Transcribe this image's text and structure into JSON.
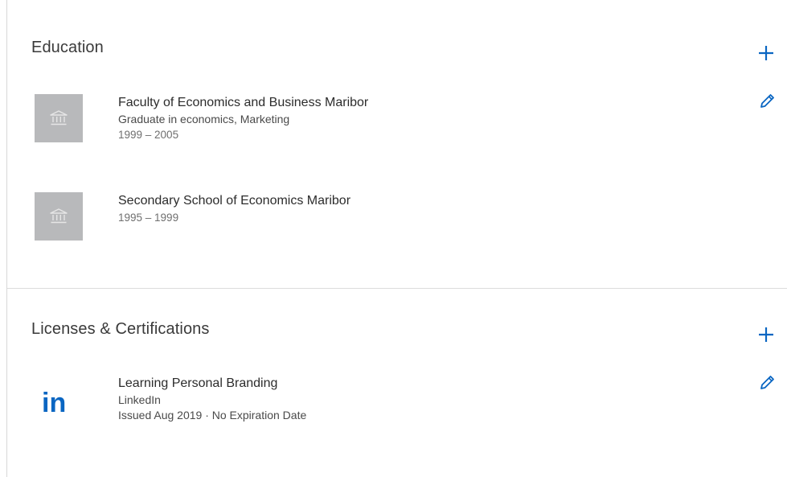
{
  "education": {
    "title": "Education",
    "add_icon": "plus-icon",
    "edit_icon": "pencil-icon",
    "entries": [
      {
        "school": "Faculty of Economics and Business Maribor",
        "degree": "Graduate in economics, Marketing",
        "dates": "1999 – 2005",
        "logo_icon": "school-building-icon"
      },
      {
        "school": "Secondary School of Economics Maribor",
        "dates": "1995 – 1999",
        "logo_icon": "school-building-icon"
      }
    ]
  },
  "licenses": {
    "title": "Licenses & Certifications",
    "add_icon": "plus-icon",
    "edit_icon": "pencil-icon",
    "entries": [
      {
        "name": "Learning Personal Branding",
        "issuer": "LinkedIn",
        "issued": "Issued Aug 2019 · No Expiration Date",
        "logo_icon": "linkedin-logo",
        "logo_text": "in"
      }
    ]
  },
  "colors": {
    "accent_blue": "#0a66c2",
    "logo_gray": "#b8b9bb",
    "linkedin_blue": "#0a66c2"
  }
}
